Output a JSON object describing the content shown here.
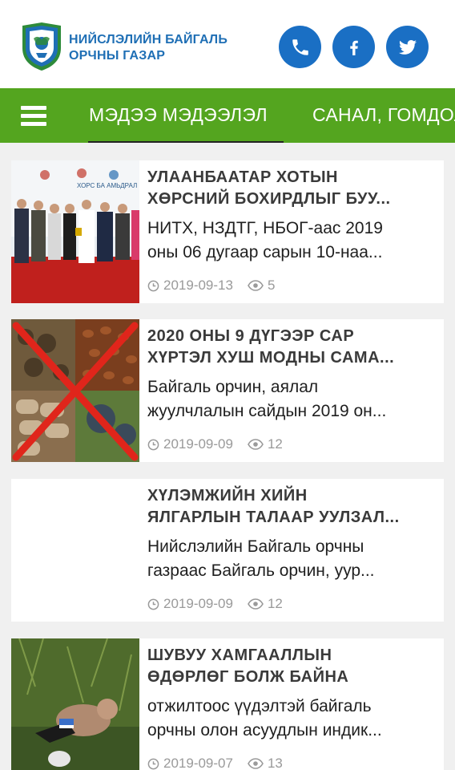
{
  "header": {
    "org_line1": "НИЙСЛЭЛИЙН БАЙГАЛЬ",
    "org_line2": "ОРЧНЫ ГАЗАР",
    "social": [
      "phone-icon",
      "facebook-icon",
      "twitter-icon"
    ],
    "colors": {
      "brand_blue": "#1a6fc4",
      "nav_green": "#54a51f"
    }
  },
  "nav": {
    "items": [
      "МЭДЭЭ МЭДЭЭЛЭЛ",
      "САНАЛ, ГОМДОЛ"
    ]
  },
  "articles": [
    {
      "title_line1": "УЛААНБААТАР ХОТЫН",
      "title_line2": "ХӨРСНИЙ БОХИРДЛЫГ БУУ...",
      "desc_line1": "НИТХ, НЗДТГ, НБОГ-аас 2019",
      "desc_line2": "оны 06 дугаар сарын 10-наа...",
      "date": "2019-09-13",
      "views": "5",
      "image_banner": "ХОРС БА АМЬДРАЛ"
    },
    {
      "title_line1": "2020 ОНЫ 9 ДҮГЭЭР САР",
      "title_line2": "ХҮРТЭЛ ХУШ МОДНЫ САМА...",
      "desc_line1": "Байгаль орчин, аялал",
      "desc_line2": "жуулчлалын сайдын 2019 он...",
      "date": "2019-09-09",
      "views": "12"
    },
    {
      "title_line1": "ХҮЛЭМЖИЙН ХИЙН",
      "title_line2": "ЯЛГАРЛЫН ТАЛААР УУЛЗАЛ...",
      "desc_line1": "Нийслэлийн Байгаль орчны",
      "desc_line2": "газраас Байгаль орчин, уур...",
      "date": "2019-09-09",
      "views": "12"
    },
    {
      "title_line1": "ШУВУУ ХАМГААЛЛЫН",
      "title_line2": "ӨДӨРЛӨГ БОЛЖ БАЙНА",
      "desc_line1": "отжилтоос үүдэлтэй байгаль",
      "desc_line2": "орчны олон асуудлын индик...",
      "date": "2019-09-07",
      "views": "13"
    }
  ]
}
